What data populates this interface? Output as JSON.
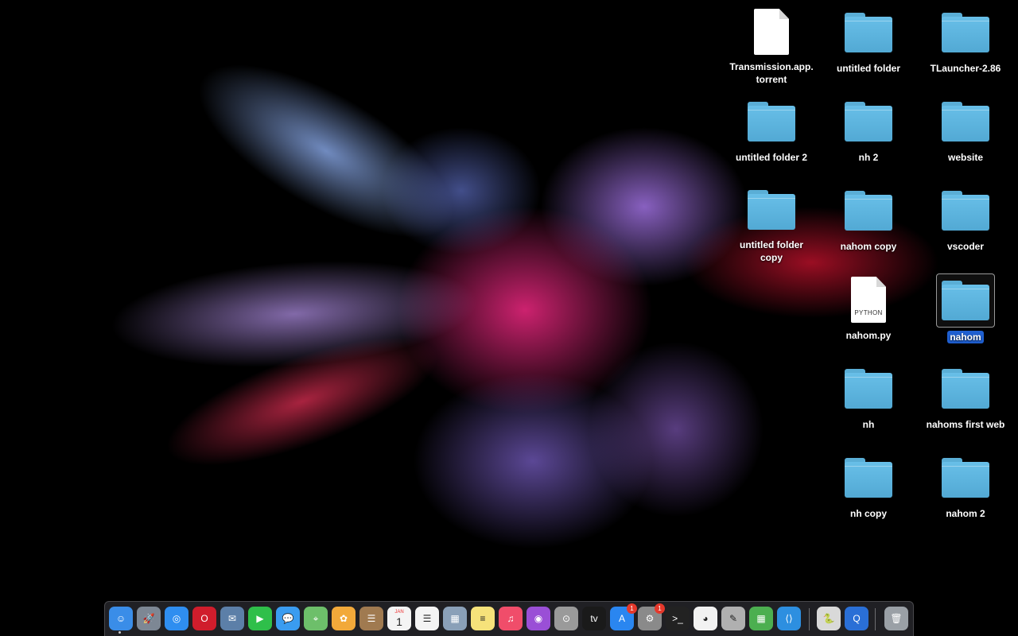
{
  "desktop": {
    "icons": [
      {
        "label": "Transmission.app.\ntorrent",
        "type": "document"
      },
      {
        "label": "untitled folder",
        "type": "folder"
      },
      {
        "label": "TLauncher-2.86",
        "type": "folder"
      },
      {
        "label": "untitled folder 2",
        "type": "folder"
      },
      {
        "label": "nh 2",
        "type": "folder"
      },
      {
        "label": "website",
        "type": "folder"
      },
      {
        "label": "untitled folder copy",
        "type": "folder"
      },
      {
        "label": "nahom copy",
        "type": "folder"
      },
      {
        "label": "vscoder",
        "type": "folder"
      },
      {
        "label": "nahom.py",
        "type": "python-document",
        "tag": "PYTHON"
      },
      {
        "label": "nahom",
        "type": "folder",
        "selected": true
      },
      {
        "label": "nh",
        "type": "folder"
      },
      {
        "label": "nahoms first web",
        "type": "folder"
      },
      {
        "label": "nh copy",
        "type": "folder"
      },
      {
        "label": "nahom 2",
        "type": "folder"
      }
    ]
  },
  "dock": {
    "items": [
      {
        "icon": "finder-icon",
        "color": "#3a8de8",
        "glyph": "☺"
      },
      {
        "icon": "launchpad-icon",
        "color": "#7d8794",
        "glyph": "🚀"
      },
      {
        "icon": "safari-icon",
        "color": "#2f8ef0",
        "glyph": "◎"
      },
      {
        "icon": "opera-icon",
        "color": "#d01d2c",
        "glyph": "O"
      },
      {
        "icon": "mail-icon",
        "color": "#5c7fa8",
        "glyph": "✉"
      },
      {
        "icon": "facetime-icon",
        "color": "#2fbf4a",
        "glyph": "▶"
      },
      {
        "icon": "messages-icon",
        "color": "#3a9cf0",
        "glyph": "💬"
      },
      {
        "icon": "maps-icon",
        "color": "#6dbf6a",
        "glyph": "⌖"
      },
      {
        "icon": "photos-icon",
        "color": "#f2a93a",
        "glyph": "✿"
      },
      {
        "icon": "contacts-icon",
        "color": "#a07a50",
        "glyph": "☰"
      },
      {
        "icon": "calendar-icon",
        "color": "#f4f4f4",
        "glyph": "1",
        "month": "JAN"
      },
      {
        "icon": "reminders-icon",
        "color": "#f4f4f4",
        "glyph": "☰"
      },
      {
        "icon": "preview-icon",
        "color": "#8aa0b8",
        "glyph": "▦"
      },
      {
        "icon": "notes-icon",
        "color": "#f6e27a",
        "glyph": "≡"
      },
      {
        "icon": "music-icon",
        "color": "#f04d6a",
        "glyph": "♫"
      },
      {
        "icon": "podcasts-icon",
        "color": "#9a4fd6",
        "glyph": "◉"
      },
      {
        "icon": "disk-utility-icon",
        "color": "#9a9a9a",
        "glyph": "⊙"
      },
      {
        "icon": "apple-tv-icon",
        "color": "#1a1a1a",
        "glyph": "tv"
      },
      {
        "icon": "app-store-icon",
        "color": "#2a86f0",
        "glyph": "A",
        "badge": "1"
      },
      {
        "icon": "system-preferences-icon",
        "color": "#8a8a8a",
        "glyph": "⚙",
        "badge": "1"
      },
      {
        "icon": "terminal-icon",
        "color": "#222222",
        "glyph": ">_"
      },
      {
        "icon": "chrome-icon",
        "color": "#f2f2f2",
        "glyph": "◕"
      },
      {
        "icon": "script-editor-icon",
        "color": "#b0b0b0",
        "glyph": "✎"
      },
      {
        "icon": "minecraft-launcher-icon",
        "color": "#4caf50",
        "glyph": "▦"
      },
      {
        "icon": "vscode-icon",
        "color": "#2d8fe0",
        "glyph": "⟨⟩"
      },
      {
        "icon": "python-launcher-icon",
        "color": "#d9d9d9",
        "glyph": "🐍"
      },
      {
        "icon": "quicktime-icon",
        "color": "#2a6fd6",
        "glyph": "Q"
      },
      {
        "icon": "trash-icon",
        "color": "#9aa0a6",
        "glyph": "🗑"
      }
    ]
  }
}
